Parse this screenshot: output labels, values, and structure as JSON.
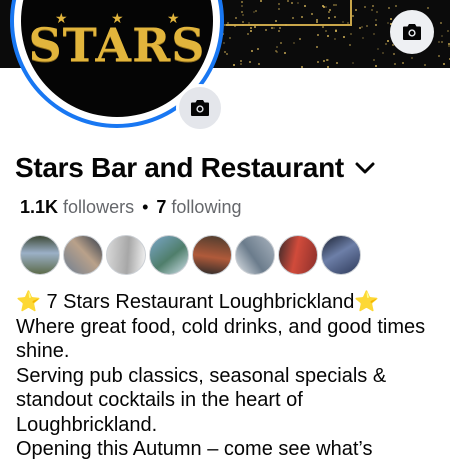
{
  "cover": {
    "camera_icon": "camera-icon"
  },
  "avatar": {
    "logo_text": "STARS",
    "camera_icon": "camera-icon"
  },
  "profile": {
    "name": "Stars Bar and Restaurant",
    "followers_count": "1.1K",
    "followers_label": "followers",
    "separator": "•",
    "following_count": "7",
    "following_label": "following"
  },
  "friends": [
    {
      "colors": [
        "#5c6b4a",
        "#9bb0c7",
        "#3e4a38"
      ]
    },
    {
      "colors": [
        "#6f7f92",
        "#b9a18a",
        "#2f3a4a"
      ]
    },
    {
      "colors": [
        "#d9d9d9",
        "#a7a7a7",
        "#f2f2f2"
      ]
    },
    {
      "colors": [
        "#7aa6c9",
        "#4f7e6b",
        "#cfe0ea"
      ]
    },
    {
      "colors": [
        "#4a3b2e",
        "#b05a3a",
        "#2a2a2a"
      ]
    },
    {
      "colors": [
        "#aab4bf",
        "#6b7c8c",
        "#e2e6ea"
      ]
    },
    {
      "colors": [
        "#8b2f2b",
        "#d14b3b",
        "#3b2a2a"
      ]
    },
    {
      "colors": [
        "#2e3a5a",
        "#6d7fa8",
        "#1b2233"
      ]
    }
  ],
  "bio": {
    "line1_emoji_left": "⭐",
    "line1_text": " 7 Stars Restaurant Loughbrickland",
    "line1_emoji_right": "⭐",
    "line2": "Where great food, cold drinks, and good times shine.",
    "line3": "Serving pub classics, seasonal specials & standout cocktails in the heart of Loughbrickland.",
    "line4": "Opening this Autumn – come see what’s"
  }
}
